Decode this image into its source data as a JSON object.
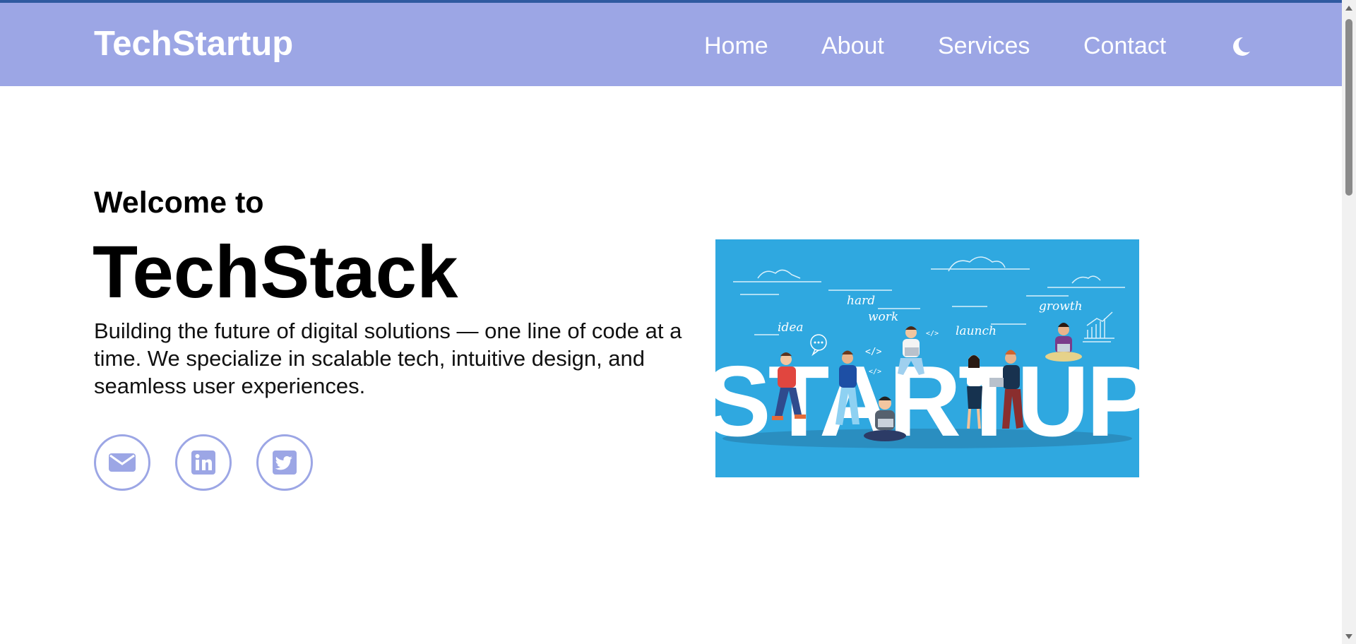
{
  "header": {
    "brand": "TechStartup",
    "nav": [
      "Home",
      "About",
      "Services",
      "Contact"
    ],
    "theme_icon": "moon-icon"
  },
  "hero": {
    "welcome": "Welcome to",
    "title": "TechStack",
    "description": "Building the future of digital solutions — one line of code at a time. We specialize in scalable tech, intuitive design, and seamless user experiences.",
    "socials": [
      "envelope-icon",
      "linkedin-icon",
      "twitter-icon"
    ],
    "image": {
      "big_word": "STARTUP",
      "words": [
        "idea",
        "hard",
        "work",
        "launch",
        "growth"
      ]
    }
  },
  "colors": {
    "navbar": "#9ca6e5",
    "top_strip": "#2f5aa0",
    "image_bg": "#2fa8e0",
    "social_outline": "#9ca6e5"
  }
}
